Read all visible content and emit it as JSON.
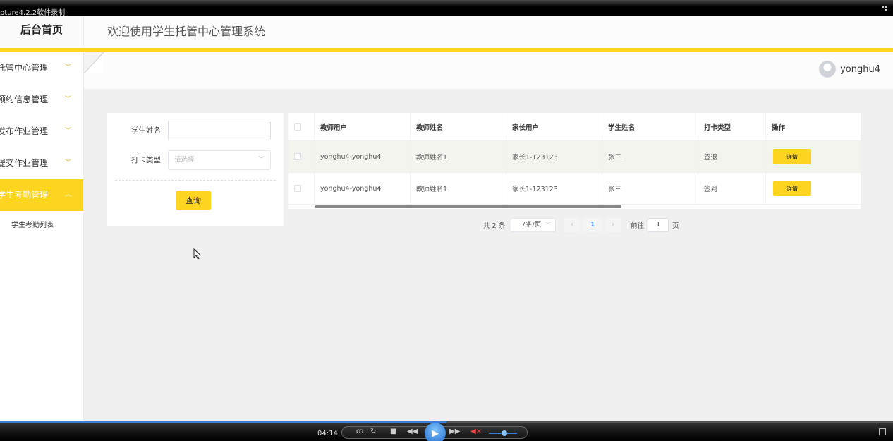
{
  "recorder": {
    "title": "pture4.2.2软件录制"
  },
  "header": {
    "logo": "后台首页",
    "system_title": "欢迎使用学生托管中心管理系统"
  },
  "sidebar": {
    "items": [
      {
        "label": "托管中心管理",
        "active": false
      },
      {
        "label": "预约信息管理",
        "active": false
      },
      {
        "label": "发布作业管理",
        "active": false
      },
      {
        "label": "提交作业管理",
        "active": false
      },
      {
        "label": "学生考勤管理",
        "active": true
      }
    ],
    "sub_items": [
      {
        "label": "学生考勤列表"
      }
    ]
  },
  "user": {
    "name": "yonghu4"
  },
  "search": {
    "name_label": "学生姓名",
    "name_value": "",
    "type_label": "打卡类型",
    "type_placeholder": "请选择",
    "query_button": "查询"
  },
  "table": {
    "columns": [
      "教师用户",
      "教师姓名",
      "家长用户",
      "学生姓名",
      "打卡类型",
      "操作"
    ],
    "rows": [
      {
        "teacher_user": "yonghu4-yonghu4",
        "teacher_name": "教师姓名1",
        "parent_user": "家长1-123123",
        "student_name": "张三",
        "punch_type": "签退",
        "action": "详情"
      },
      {
        "teacher_user": "yonghu4-yonghu4",
        "teacher_name": "教师姓名1",
        "parent_user": "家长1-123123",
        "student_name": "张三",
        "punch_type": "签到",
        "action": "详情"
      }
    ]
  },
  "pagination": {
    "total": "共 2 条",
    "page_size": "7条/页",
    "current_page": "1",
    "goto_label": "前往",
    "goto_value": "1",
    "page_unit": "页"
  },
  "player": {
    "time": "04:14",
    "progress": 0.5
  },
  "colors": {
    "accent": "#fdd520",
    "link": "#3e8ef7",
    "player_blue": "#3d7fd6"
  }
}
